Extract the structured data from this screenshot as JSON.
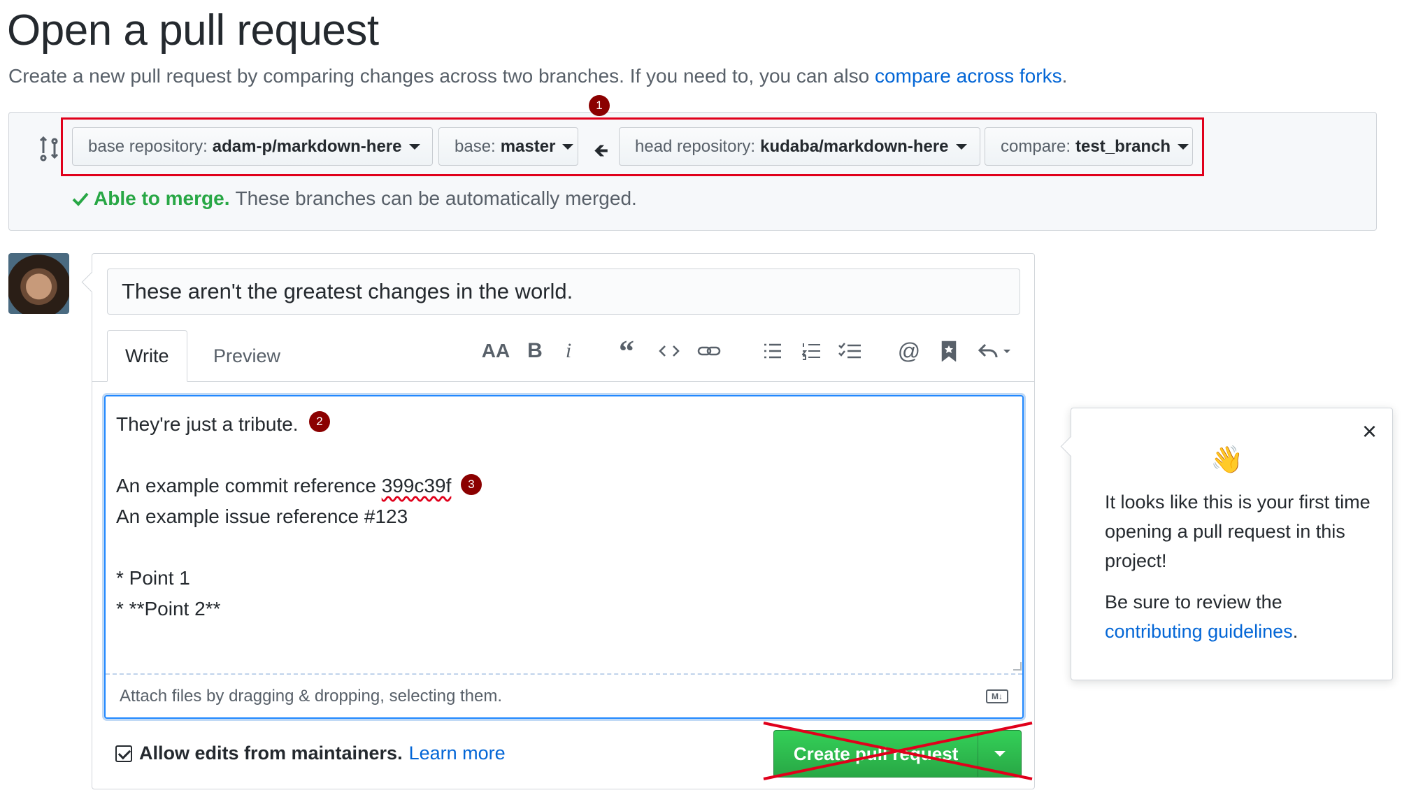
{
  "page": {
    "title": "Open a pull request",
    "subtitle": "Create a new pull request by comparing changes across two branches. If you need to, you can also ",
    "subtitle_link": "compare across forks",
    "subtitle_end": "."
  },
  "compare": {
    "base_repo_label": "base repository:",
    "base_repo_value": "adam-p/markdown-here",
    "base_label": "base:",
    "base_value": "master",
    "head_repo_label": "head repository:",
    "head_repo_value": "kudaba/markdown-here",
    "compare_label": "compare:",
    "compare_value": "test_branch",
    "merge_ok": "Able to merge.",
    "merge_text": "These branches can be automatically merged."
  },
  "markers": {
    "m1": "1",
    "m2": "2",
    "m3": "3"
  },
  "form": {
    "title_value": "These aren't the greatest changes in the world.",
    "tab_write": "Write",
    "tab_preview": "Preview",
    "toolbar": [
      "header-icon",
      "bold-icon",
      "italic-icon",
      "quote-icon",
      "code-icon",
      "link-icon",
      "unordered-list-icon",
      "ordered-list-icon",
      "task-list-icon",
      "mention-icon",
      "bookmark-icon",
      "reply-icon"
    ],
    "body_lines": {
      "l1": "They're just a tribute.",
      "l3a": "An example commit reference ",
      "l3b": "399c39f",
      "l4": "An example issue reference #123",
      "l6": "* Point 1",
      "l7": "* **Point 2**"
    },
    "attach_text": "Attach files by dragging & dropping, selecting them.",
    "md_badge": "M↓",
    "allow_edits": "Allow edits from maintainers.",
    "learn_more": "Learn more",
    "allow_checked": true,
    "create_button": "Create pull request"
  },
  "popover": {
    "wave": "👋",
    "text": "It looks like this is your first time opening a pull request in this project!",
    "text2": "Be sure to review the ",
    "link": "contributing guidelines",
    "text2_end": ".",
    "close": "×"
  },
  "colors": {
    "link": "#0366d6",
    "success": "#28a745",
    "annotation_red": "#e0001b",
    "marker": "#8b0000"
  }
}
